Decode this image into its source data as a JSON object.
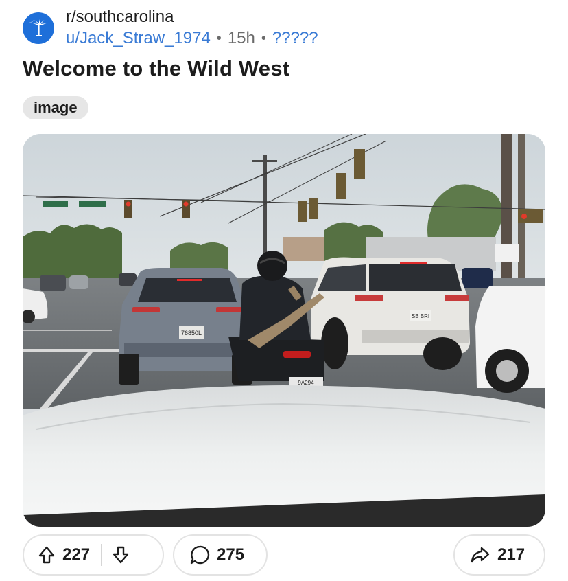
{
  "post": {
    "subreddit": "r/southcarolina",
    "author": "u/Jack_Straw_1974",
    "separator": "•",
    "age": "15h",
    "flair": "?????",
    "title": "Welcome to the Wild West",
    "tag": "image"
  },
  "image": {
    "plates": {
      "suv_left": "76850L",
      "suv_right": "SB BRI",
      "motorcycle": "9A294"
    }
  },
  "actions": {
    "upvotes": "227",
    "comments": "275",
    "shares": "217"
  },
  "colors": {
    "avatar_bg": "#1e6fd9",
    "link_blue": "#3a7bd5",
    "tag_bg": "#e6e6e6"
  },
  "icons": {
    "avatar": "palmetto-moon-icon",
    "upvote": "arrow-up-icon",
    "downvote": "arrow-down-icon",
    "comment": "speech-bubble-icon",
    "share": "share-arrow-icon"
  }
}
